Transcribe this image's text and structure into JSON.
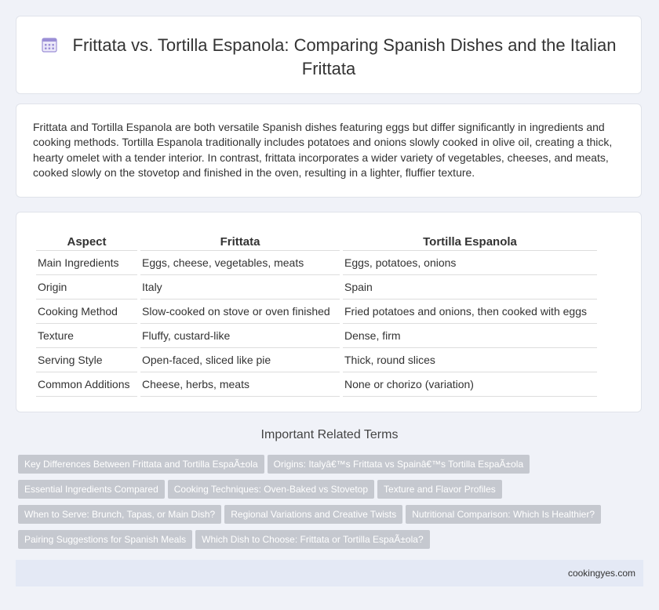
{
  "header": {
    "icon": "calendar-icon",
    "title": "Frittata vs. Tortilla Espanola: Comparing Spanish Dishes and the Italian Frittata"
  },
  "intro": {
    "text": "Frittata and Tortilla Espanola are both versatile Spanish dishes featuring eggs but differ significantly in ingredients and cooking methods. Tortilla Espanola traditionally includes potatoes and onions slowly cooked in olive oil, creating a thick, hearty omelet with a tender interior. In contrast, frittata incorporates a wider variety of vegetables, cheeses, and meats, cooked slowly on the stovetop and finished in the oven, resulting in a lighter, fluffier texture."
  },
  "table": {
    "headers": [
      "Aspect",
      "Frittata",
      "Tortilla Espanola"
    ],
    "rows": [
      [
        "Main Ingredients",
        "Eggs, cheese, vegetables, meats",
        "Eggs, potatoes, onions"
      ],
      [
        "Origin",
        "Italy",
        "Spain"
      ],
      [
        "Cooking Method",
        "Slow-cooked on stove or oven finished",
        "Fried potatoes and onions, then cooked with eggs"
      ],
      [
        "Texture",
        "Fluffy, custard-like",
        "Dense, firm"
      ],
      [
        "Serving Style",
        "Open-faced, sliced like pie",
        "Thick, round slices"
      ],
      [
        "Common Additions",
        "Cheese, herbs, meats",
        "None or chorizo (variation)"
      ]
    ]
  },
  "related": {
    "title": "Important Related Terms",
    "rows": [
      [
        "Key Differences Between Frittata and Tortilla EspaÃ±ola",
        "Origins: Italyâ€™s Frittata vs Spainâ€™s Tortilla EspaÃ±ola"
      ],
      [
        "Essential Ingredients Compared",
        "Cooking Techniques: Oven-Baked vs Stovetop",
        "Texture and Flavor Profiles"
      ],
      [
        "When to Serve: Brunch, Tapas, or Main Dish?",
        "Regional Variations and Creative Twists",
        "Nutritional Comparison: Which Is Healthier?"
      ],
      [
        "Pairing Suggestions for Spanish Meals",
        "Which Dish to Choose: Frittata or Tortilla EspaÃ±ola?"
      ]
    ]
  },
  "footer": {
    "site": "cookingyes.com"
  },
  "colors": {
    "background": "#f0f2f8",
    "tag": "#c5c8cf",
    "footer": "#e4e9f5",
    "icon": "#9b8fd6"
  }
}
